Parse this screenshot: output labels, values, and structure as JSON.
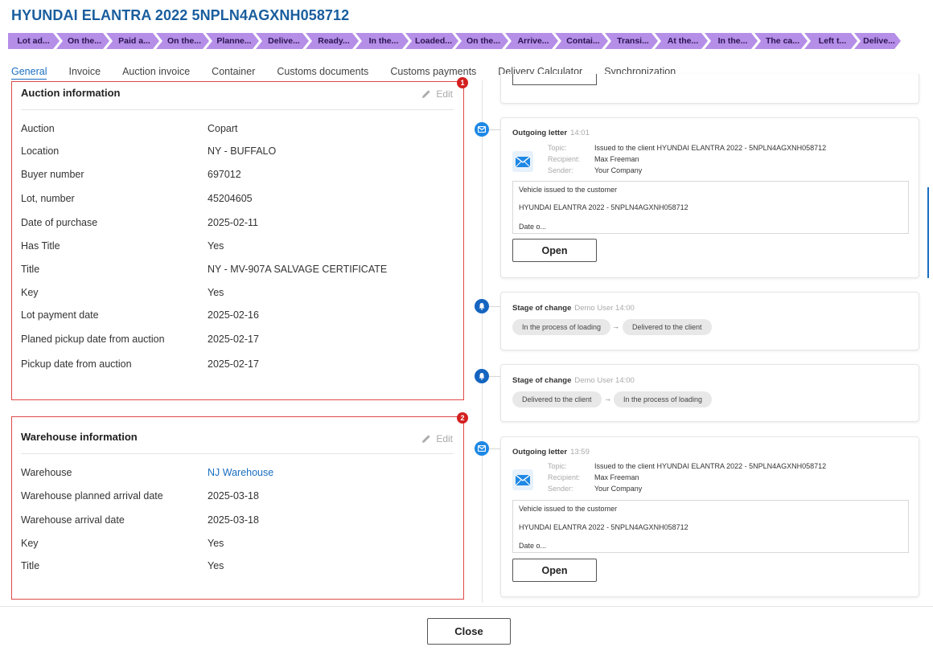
{
  "title": "HYUNDAI ELANTRA 2022 5NPLN4AGXNH058712",
  "stages": [
    "Lot ad...",
    "On the...",
    "Paid a...",
    "On the...",
    "Planne...",
    "Delive...",
    "Ready...",
    "In the...",
    "Loaded...",
    "On the...",
    "Arrive...",
    "Contai...",
    "Transi...",
    "At the...",
    "In the...",
    "The ca...",
    "Left t...",
    "Delive..."
  ],
  "tabs": [
    "General",
    "Invoice",
    "Auction invoice",
    "Container",
    "Customs documents",
    "Customs payments",
    "Delivery Calculator",
    "Synchronization"
  ],
  "auction": {
    "badge": "1",
    "title": "Auction information",
    "edit_label": "Edit",
    "rows": [
      {
        "label": "Auction",
        "value": "Copart"
      },
      {
        "label": "Location",
        "value": "NY - BUFFALO"
      },
      {
        "label": "Buyer number",
        "value": "697012"
      },
      {
        "label": "Lot, number",
        "value": "45204605"
      },
      {
        "label": "Date of purchase",
        "value": "2025-02-11"
      },
      {
        "label": "Has Title",
        "value": "Yes"
      },
      {
        "label": "Title",
        "value": "NY - MV-907A SALVAGE CERTIFICATE"
      },
      {
        "label": "Key",
        "value": "Yes"
      },
      {
        "label": "Lot payment date",
        "value": "2025-02-16"
      },
      {
        "label": "Planed pickup date from auction",
        "value": "2025-02-17"
      },
      {
        "label": "Pickup date from auction",
        "value": "2025-02-17"
      }
    ]
  },
  "warehouse": {
    "badge": "2",
    "title": "Warehouse information",
    "edit_label": "Edit",
    "rows": [
      {
        "label": "Warehouse",
        "value": "NJ Warehouse"
      },
      {
        "label": "Warehouse planned arrival date",
        "value": "2025-03-18"
      },
      {
        "label": "Warehouse arrival date",
        "value": "2025-03-18"
      },
      {
        "label": "Key",
        "value": "Yes"
      },
      {
        "label": "Title",
        "value": "Yes"
      }
    ]
  },
  "timeline": {
    "letter1": {
      "title": "Outgoing letter",
      "time": "14:01",
      "topic_label": "Topic:",
      "topic": "Issued to the client HYUNDAI ELANTRA 2022 - 5NPLN4AGXNH058712",
      "recipient_label": "Recipient:",
      "recipient": "Max Freeman",
      "sender_label": "Sender:",
      "sender": "Your Company",
      "body_line1": "Vehicle issued to the customer",
      "body_line2": "HYUNDAI ELANTRA 2022 - 5NPLN4AGXNH058712",
      "body_line3": "Date o...",
      "open_label": "Open"
    },
    "stage1": {
      "title": "Stage of change",
      "meta": "Demo User 14:00",
      "from": "In the process of loading",
      "to": "Delivered to the client",
      "arrow": "→"
    },
    "stage2": {
      "title": "Stage of change",
      "meta": "Demo User 14:00",
      "from": "Delivered to the client",
      "to": "In the process of loading",
      "arrow": "→"
    },
    "letter2": {
      "title": "Outgoing letter",
      "time": "13:59",
      "topic_label": "Topic:",
      "topic": "Issued to the client HYUNDAI ELANTRA 2022 - 5NPLN4AGXNH058712",
      "recipient_label": "Recipient:",
      "recipient": "Max Freeman",
      "sender_label": "Sender:",
      "sender": "Your Company",
      "body_line1": "Vehicle issued to the customer",
      "body_line2": "HYUNDAI ELANTRA 2022 - 5NPLN4AGXNH058712",
      "body_line3": "Date o...",
      "open_label": "Open"
    }
  },
  "close_label": "Close",
  "colors": {
    "accent": "#1a6ec0",
    "title": "#1a5e9e",
    "stage": "#b58ee8",
    "highlight_border": "#e04848",
    "badge": "#d41f1f"
  },
  "icons": {
    "edit": "pencil-icon",
    "mail": "envelope-icon",
    "bell": "bell-icon"
  }
}
